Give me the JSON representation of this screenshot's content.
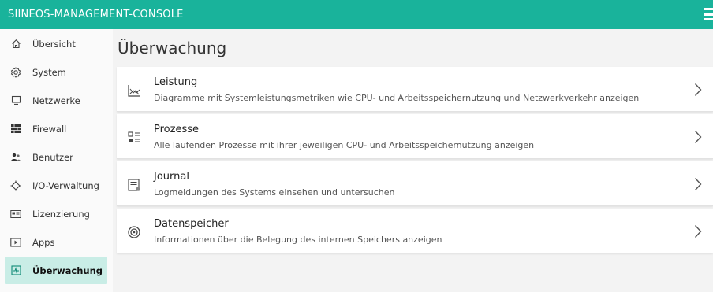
{
  "app": {
    "title": "SIINEOS-MANAGEMENT-CONSOLE"
  },
  "colors": {
    "brand": "#19b39b",
    "active_bg": "#c9ede6"
  },
  "sidebar": {
    "items": [
      {
        "label": "Übersicht",
        "icon": "home-icon"
      },
      {
        "label": "System",
        "icon": "gear-icon"
      },
      {
        "label": "Netzwerke",
        "icon": "monitor-icon"
      },
      {
        "label": "Firewall",
        "icon": "firewall-icon"
      },
      {
        "label": "Benutzer",
        "icon": "users-icon"
      },
      {
        "label": "I/O-Verwaltung",
        "icon": "io-icon"
      },
      {
        "label": "Lizenzierung",
        "icon": "license-icon"
      },
      {
        "label": "Apps",
        "icon": "apps-icon"
      },
      {
        "label": "Überwachung",
        "icon": "monitoring-icon",
        "active": true
      }
    ]
  },
  "main": {
    "title": "Überwachung",
    "cards": [
      {
        "title": "Leistung",
        "description": "Diagramme mit Systemleistungsmetriken wie CPU- und Arbeitsspeichernutzung und Netzwerkverkehr anzeigen",
        "icon": "chart-icon"
      },
      {
        "title": "Prozesse",
        "description": "Alle laufenden Prozesse mit ihrer jeweiligen CPU- und Arbeitsspeichernutzung anzeigen",
        "icon": "process-list-icon"
      },
      {
        "title": "Journal",
        "description": "Logmeldungen des Systems einsehen und untersuchen",
        "icon": "journal-icon"
      },
      {
        "title": "Datenspeicher",
        "description": "Informationen über die Belegung des internen Speichers anzeigen",
        "icon": "storage-icon"
      }
    ]
  }
}
